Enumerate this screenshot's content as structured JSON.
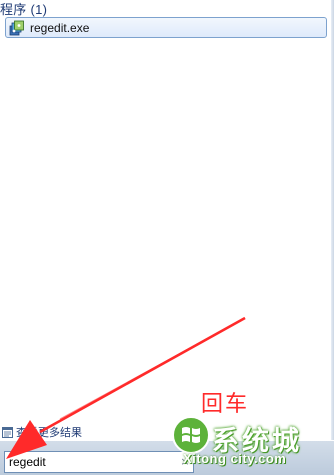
{
  "programs_section": {
    "header": "程序 (1)",
    "results": [
      {
        "label": "regedit.exe",
        "icon": "regedit-icon"
      }
    ]
  },
  "see_more": {
    "label": "查看更多结果",
    "icon": "search-results-icon"
  },
  "search": {
    "value": "regedit",
    "clear_label": "×"
  },
  "annotation": {
    "enter_label": "回车",
    "arrow_color": "#ff2a2a"
  },
  "watermark": {
    "chinese": "系统城",
    "english": "Xitong city.com",
    "logo_color": "#5db23a"
  }
}
